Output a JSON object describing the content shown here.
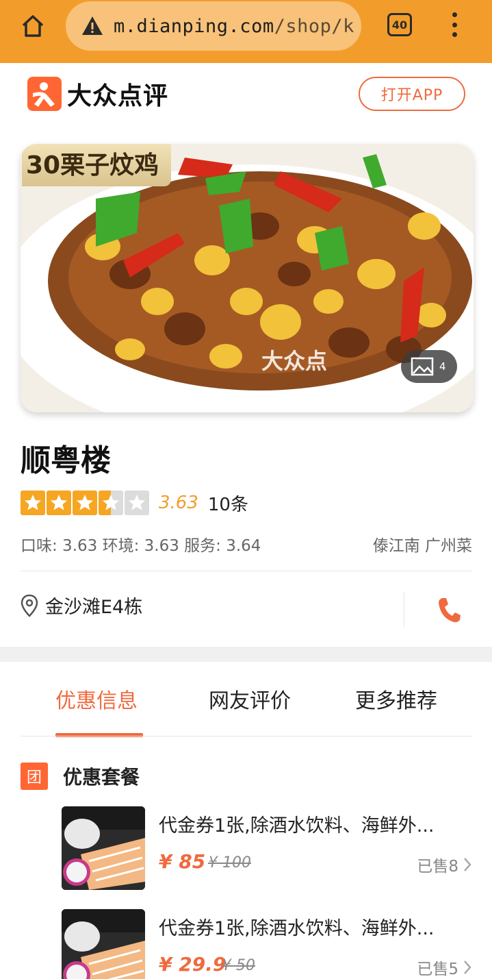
{
  "browser": {
    "url_host": "m.dianping.com",
    "url_path": "/shop/k",
    "tab_count": "40",
    "home_icon": "home-icon",
    "warning_icon": "warning-triangle-icon",
    "menu_icon": "more-vertical-icon"
  },
  "header": {
    "logo_text": "大众点评",
    "open_app_label": "打开APP"
  },
  "hero": {
    "label": "30栗子炆鸡",
    "watermark": "大众点",
    "photo_count": "4"
  },
  "shop": {
    "name": "顺粤楼",
    "stars": 3.5,
    "score": "3.63",
    "review_count": "10条",
    "sub_scores": "口味: 3.63 环境: 3.63 服务: 3.64",
    "location_category": "傣江南 广州菜",
    "address": "金沙滩E4栋"
  },
  "tabs": [
    {
      "label": "优惠信息",
      "active": true
    },
    {
      "label": "网友评价",
      "active": false
    },
    {
      "label": "更多推荐",
      "active": false
    }
  ],
  "deals": {
    "icon_text": "团",
    "title": "优惠套餐",
    "items": [
      {
        "title": "代金券1张,除酒水饮料、海鲜外...",
        "price": "¥ 85",
        "original": "¥ 100",
        "sold": "已售8"
      },
      {
        "title": "代金券1张,除酒水饮料、海鲜外...",
        "price": "¥ 29.9",
        "original": "¥ 50",
        "sold": "已售5"
      }
    ]
  },
  "colors": {
    "browser_bar": "#f29d2b",
    "accent": "#f06a3e",
    "star": "#f6a623"
  }
}
